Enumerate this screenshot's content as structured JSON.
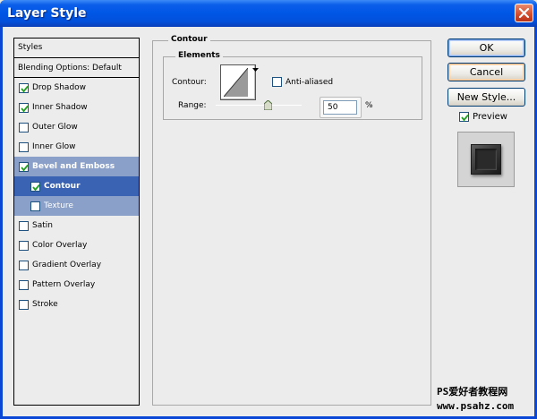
{
  "window": {
    "title": "Layer Style"
  },
  "styles_panel": {
    "header": "Styles",
    "blending_options": "Blending Options: Default",
    "items": [
      {
        "label": "Drop Shadow",
        "checked": true
      },
      {
        "label": "Inner Shadow",
        "checked": true
      },
      {
        "label": "Outer Glow",
        "checked": false
      },
      {
        "label": "Inner Glow",
        "checked": false
      },
      {
        "label": "Bevel and Emboss",
        "checked": true
      },
      {
        "label": "Contour",
        "checked": true
      },
      {
        "label": "Texture",
        "checked": false
      },
      {
        "label": "Satin",
        "checked": false
      },
      {
        "label": "Color Overlay",
        "checked": false
      },
      {
        "label": "Gradient Overlay",
        "checked": false
      },
      {
        "label": "Pattern Overlay",
        "checked": false
      },
      {
        "label": "Stroke",
        "checked": false
      }
    ]
  },
  "contour_section": {
    "title": "Contour",
    "elements_title": "Elements",
    "contour_label": "Contour:",
    "anti_aliased_label": "Anti-aliased",
    "anti_aliased": false,
    "range_label": "Range:",
    "range_value": "50",
    "range_unit": "%"
  },
  "buttons": {
    "ok": "OK",
    "cancel": "Cancel",
    "new_style": "New Style..."
  },
  "preview": {
    "label": "Preview",
    "checked": true
  },
  "watermark": {
    "line1": "PS爱好者教程网",
    "line2": "www.psahz.com"
  }
}
